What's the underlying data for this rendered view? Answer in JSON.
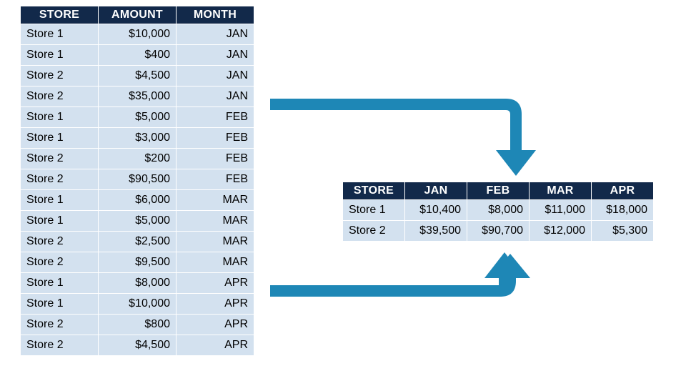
{
  "colors": {
    "header_bg": "#12294a",
    "cell_bg": "#d3e1ef",
    "arrow": "#1e87b6"
  },
  "raw": {
    "headers": [
      "STORE",
      "AMOUNT",
      "MONTH"
    ],
    "rows": [
      {
        "store": "Store 1",
        "amount": "$10,000",
        "month": "JAN"
      },
      {
        "store": "Store 1",
        "amount": "$400",
        "month": "JAN"
      },
      {
        "store": "Store 2",
        "amount": "$4,500",
        "month": "JAN"
      },
      {
        "store": "Store 2",
        "amount": "$35,000",
        "month": "JAN"
      },
      {
        "store": "Store 1",
        "amount": "$5,000",
        "month": "FEB"
      },
      {
        "store": "Store 1",
        "amount": "$3,000",
        "month": "FEB"
      },
      {
        "store": "Store 2",
        "amount": "$200",
        "month": "FEB"
      },
      {
        "store": "Store 2",
        "amount": "$90,500",
        "month": "FEB"
      },
      {
        "store": "Store 1",
        "amount": "$6,000",
        "month": "MAR"
      },
      {
        "store": "Store 1",
        "amount": "$5,000",
        "month": "MAR"
      },
      {
        "store": "Store 2",
        "amount": "$2,500",
        "month": "MAR"
      },
      {
        "store": "Store 2",
        "amount": "$9,500",
        "month": "MAR"
      },
      {
        "store": "Store 1",
        "amount": "$8,000",
        "month": "APR"
      },
      {
        "store": "Store 1",
        "amount": "$10,000",
        "month": "APR"
      },
      {
        "store": "Store 2",
        "amount": "$800",
        "month": "APR"
      },
      {
        "store": "Store 2",
        "amount": "$4,500",
        "month": "APR"
      }
    ]
  },
  "pivot": {
    "headers": [
      "STORE",
      "JAN",
      "FEB",
      "MAR",
      "APR"
    ],
    "rows": [
      {
        "store": "Store 1",
        "jan": "$10,400",
        "feb": "$8,000",
        "mar": "$11,000",
        "apr": "$18,000"
      },
      {
        "store": "Store 2",
        "jan": "$39,500",
        "feb": "$90,700",
        "mar": "$12,000",
        "apr": "$5,300"
      }
    ]
  }
}
